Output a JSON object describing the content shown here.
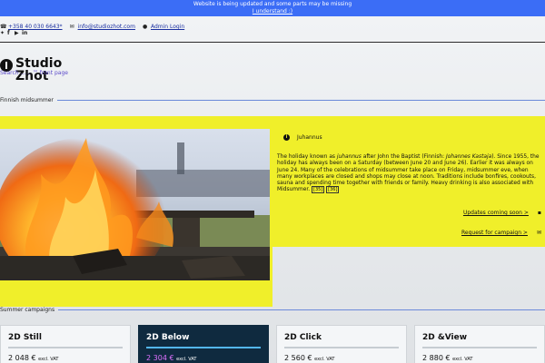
{
  "notice": {
    "text": "Website is being updated and some parts may be missing",
    "link": "I understand :)"
  },
  "contact": {
    "phone": "+358 40 030 6643*",
    "email": "info@studiozhot.com",
    "admin": "Admin Login"
  },
  "social": [
    "twitter-icon",
    "facebook-icon",
    "youtube-icon",
    "linkedin-icon"
  ],
  "logo": {
    "line1": "Studio",
    "line2": "Zhot"
  },
  "search_link": "Search ... .. ™ front page",
  "sections": {
    "midsummer": "Finnish midsummer",
    "campaigns": "Summer campaigns"
  },
  "article": {
    "title": "Juhannus",
    "text_parts": [
      "The holiday known as ",
      "juhannus",
      " after John the Baptist (Finnish: ",
      "Johannes Kastaja",
      "). Since 1955, the holiday has always been on a Saturday (between June 20 and June 26). Earlier it was always on June 24. Many of the celebrations of midsummer take place on Friday, midsummer eve, when many workplaces are closed and shops may close at noon. Traditions include bonfires, cookouts, sauna and spending time together with friends or family. Heavy drinking is also associated with Midsummer."
    ],
    "ref1": "[35]",
    "ref2": "[36]",
    "cta1": "Updates coming soon >",
    "cta2": "Request for campaign >"
  },
  "cards": [
    {
      "name": "2D Still",
      "price": "2 048 €",
      "vat": "excl. VAT"
    },
    {
      "name": "2D Below",
      "price": "2 304 €",
      "vat": "excl. VAT"
    },
    {
      "name": "2D Click",
      "price": "2 560 €",
      "vat": "excl. VAT"
    },
    {
      "name": "2D &View",
      "price": "2 880 €",
      "vat": "excl. VAT"
    }
  ]
}
